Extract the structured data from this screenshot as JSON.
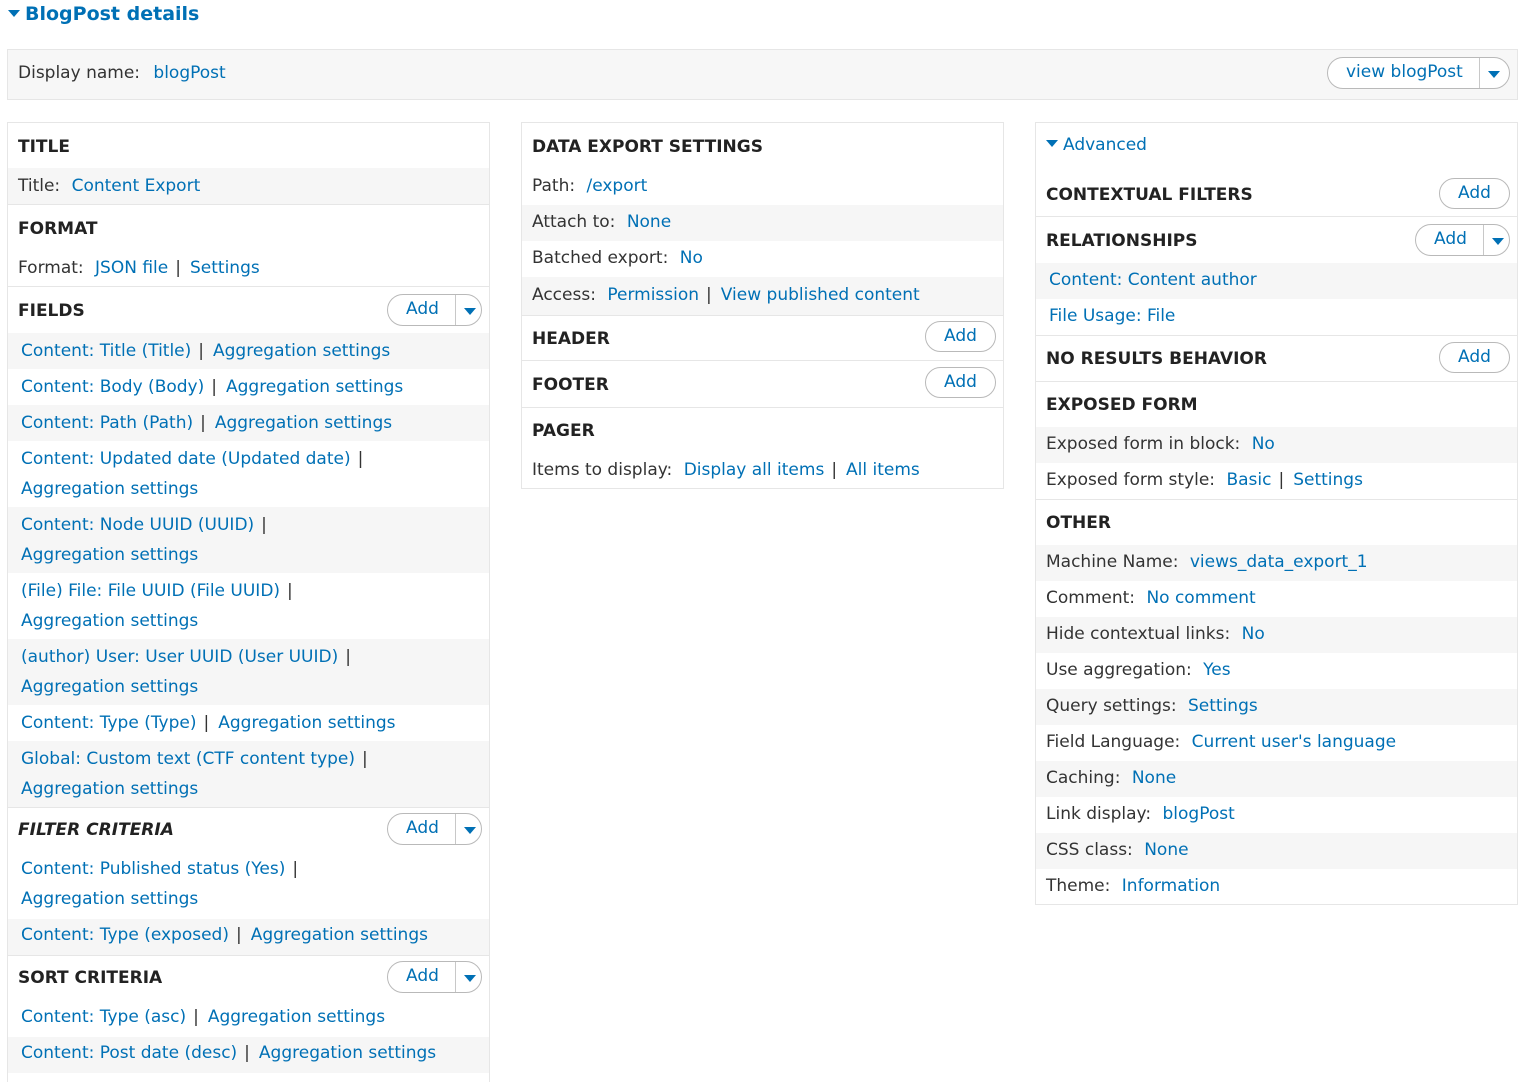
{
  "header": {
    "title": "BlogPost details",
    "display_label": "Display name:",
    "display_value": "blogPost",
    "view_button": "view blogPost"
  },
  "col1": {
    "title_section": {
      "heading": "TITLE",
      "label": "Title:",
      "value": "Content Export"
    },
    "format_section": {
      "heading": "FORMAT",
      "label": "Format:",
      "value": "JSON file",
      "settings": "Settings"
    },
    "fields": {
      "heading": "FIELDS",
      "add": "Add",
      "items": [
        {
          "text": "Content: Title (Title)",
          "agg": "Aggregation settings"
        },
        {
          "text": "Content: Body (Body)",
          "agg": "Aggregation settings"
        },
        {
          "text": "Content: Path (Path)",
          "agg": "Aggregation settings"
        },
        {
          "text": "Content: Updated date (Updated date)",
          "agg": "Aggregation settings"
        },
        {
          "text": "Content: Node UUID (UUID)",
          "agg": "Aggregation settings"
        },
        {
          "text": "(File) File: File UUID (File UUID)",
          "agg": "Aggregation settings"
        },
        {
          "text": "(author) User: User UUID (User UUID)",
          "agg": "Aggregation settings"
        },
        {
          "text": "Content: Type (Type)",
          "agg": "Aggregation settings"
        },
        {
          "text": "Global: Custom text (CTF content type)",
          "agg": "Aggregation settings"
        }
      ]
    },
    "filter": {
      "heading": "FILTER CRITERIA",
      "add": "Add",
      "items": [
        {
          "text": "Content: Published status (Yes)",
          "agg": "Aggregation settings"
        },
        {
          "text": "Content: Type (exposed)",
          "agg": "Aggregation settings"
        }
      ]
    },
    "sort": {
      "heading": "SORT CRITERIA",
      "add": "Add",
      "items": [
        {
          "text": "Content: Type (asc)",
          "agg": "Aggregation settings"
        },
        {
          "text": "Content: Post date (desc)",
          "agg": "Aggregation settings"
        }
      ]
    }
  },
  "col2": {
    "export": {
      "heading": "DATA EXPORT SETTINGS",
      "path_label": "Path:",
      "path_value": "/export",
      "attach_label": "Attach to:",
      "attach_value": "None",
      "batched_label": "Batched export:",
      "batched_value": "No",
      "access_label": "Access:",
      "access_value": "Permission",
      "access_extra": "View published content"
    },
    "header_section": {
      "heading": "HEADER",
      "add": "Add"
    },
    "footer_section": {
      "heading": "FOOTER",
      "add": "Add"
    },
    "pager": {
      "heading": "PAGER",
      "label": "Items to display:",
      "value": "Display all items",
      "extra": "All items"
    }
  },
  "col3": {
    "advanced": "Advanced",
    "contextual": {
      "heading": "CONTEXTUAL FILTERS",
      "add": "Add"
    },
    "relationships": {
      "heading": "RELATIONSHIPS",
      "add": "Add",
      "items": [
        "Content: Content author",
        "File Usage: File"
      ]
    },
    "no_results": {
      "heading": "NO RESULTS BEHAVIOR",
      "add": "Add"
    },
    "exposed": {
      "heading": "EXPOSED FORM",
      "block_label": "Exposed form in block:",
      "block_value": "No",
      "style_label": "Exposed form style:",
      "style_value": "Basic",
      "style_settings": "Settings"
    },
    "other": {
      "heading": "OTHER",
      "rows": [
        {
          "label": "Machine Name:",
          "value": "views_data_export_1"
        },
        {
          "label": "Comment:",
          "value": "No comment"
        },
        {
          "label": "Hide contextual links:",
          "value": "No"
        },
        {
          "label": "Use aggregation:",
          "value": "Yes"
        },
        {
          "label": "Query settings:",
          "value": "Settings"
        },
        {
          "label": "Field Language:",
          "value": "Current user's language"
        },
        {
          "label": "Caching:",
          "value": "None"
        },
        {
          "label": "Link display:",
          "value": "blogPost"
        },
        {
          "label": "CSS class:",
          "value": "None"
        },
        {
          "label": "Theme:",
          "value": "Information"
        }
      ]
    }
  },
  "colors": {
    "link": "#0070b5",
    "row_alt": "#f6f6f6",
    "border": "#e6e6e6"
  }
}
